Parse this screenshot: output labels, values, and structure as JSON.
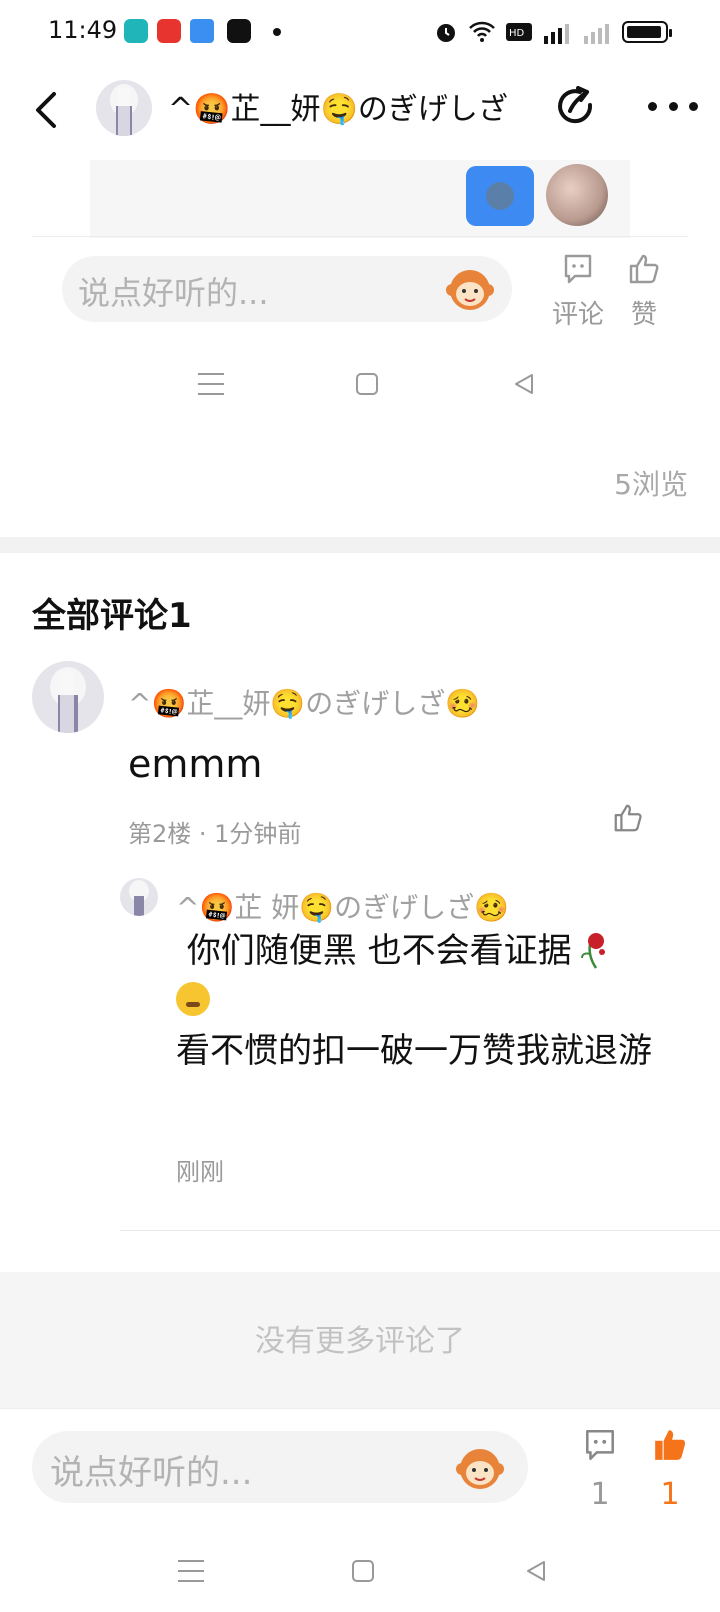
{
  "status_bar": {
    "time": "11:49",
    "app_icons": [
      "home-app-icon",
      "netease-music-icon",
      "blue-app-icon",
      "news-app-icon"
    ]
  },
  "header": {
    "title": "^🤬芷__妍🤤のぎげしざ",
    "back_icon": "chevron-left-icon",
    "share_icon": "share-icon",
    "more_icon": "more-dots-icon"
  },
  "embedded_screenshot": {
    "comment_placeholder": "说点好听的...",
    "comment_label": "评论",
    "like_label": "赞"
  },
  "post_stats": {
    "views": "5浏览"
  },
  "comments": {
    "title": "全部评论1",
    "items": [
      {
        "author": "^🤬芷__妍🤤のぎげしざ🥴",
        "text": "emmm",
        "meta": "第2楼 · 1分钟前",
        "replies": [
          {
            "author": "^🤬芷  妍🤤のぎげしざ🥴",
            "line1": "你们随便黑 也不会看证据",
            "line2": "看不惯的扣一破一万赞我就退游",
            "time": "刚刚"
          }
        ]
      }
    ],
    "no_more": "没有更多评论了"
  },
  "bottom_bar": {
    "placeholder": "说点好听的...",
    "comment_count": "1",
    "like_count": "1",
    "like_color": "#f5741a"
  }
}
